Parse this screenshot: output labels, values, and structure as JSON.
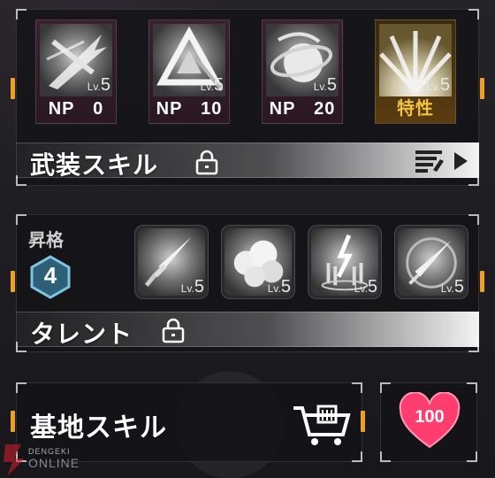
{
  "noble_skills": [
    {
      "level_prefix": "Lv.",
      "level": "5",
      "label": "NP　0",
      "icon": "sword-slash-icon"
    },
    {
      "level_prefix": "Lv.",
      "level": "5",
      "label": "NP　10",
      "icon": "triangle-burst-icon"
    },
    {
      "level_prefix": "Lv.",
      "level": "5",
      "label": "NP　20",
      "icon": "orb-swirl-icon"
    },
    {
      "level_prefix": "Lv.",
      "level": "5",
      "label": "特性",
      "icon": "radiant-burst-icon"
    }
  ],
  "weapon_skill": {
    "title": "武装スキル",
    "locked": true
  },
  "ascension": {
    "label": "昇格",
    "value": "4"
  },
  "talents": [
    {
      "level_prefix": "Lv.",
      "level": "5",
      "icon": "dagger-icon"
    },
    {
      "level_prefix": "Lv.",
      "level": "5",
      "icon": "smoke-cloud-icon"
    },
    {
      "level_prefix": "Lv.",
      "level": "5",
      "icon": "lightning-pillars-icon"
    },
    {
      "level_prefix": "Lv.",
      "level": "5",
      "icon": "comet-arrow-icon"
    }
  ],
  "talent_bar": {
    "title": "タレント",
    "locked": true
  },
  "base_skill": {
    "title": "基地スキル"
  },
  "affinity": {
    "value": "100"
  },
  "colors": {
    "accent": "#f0a020",
    "trait": "#f2c242",
    "heart": "#ff3d6e"
  },
  "watermark": {
    "line1": "DENGEKI",
    "line2": "ONLINE"
  }
}
